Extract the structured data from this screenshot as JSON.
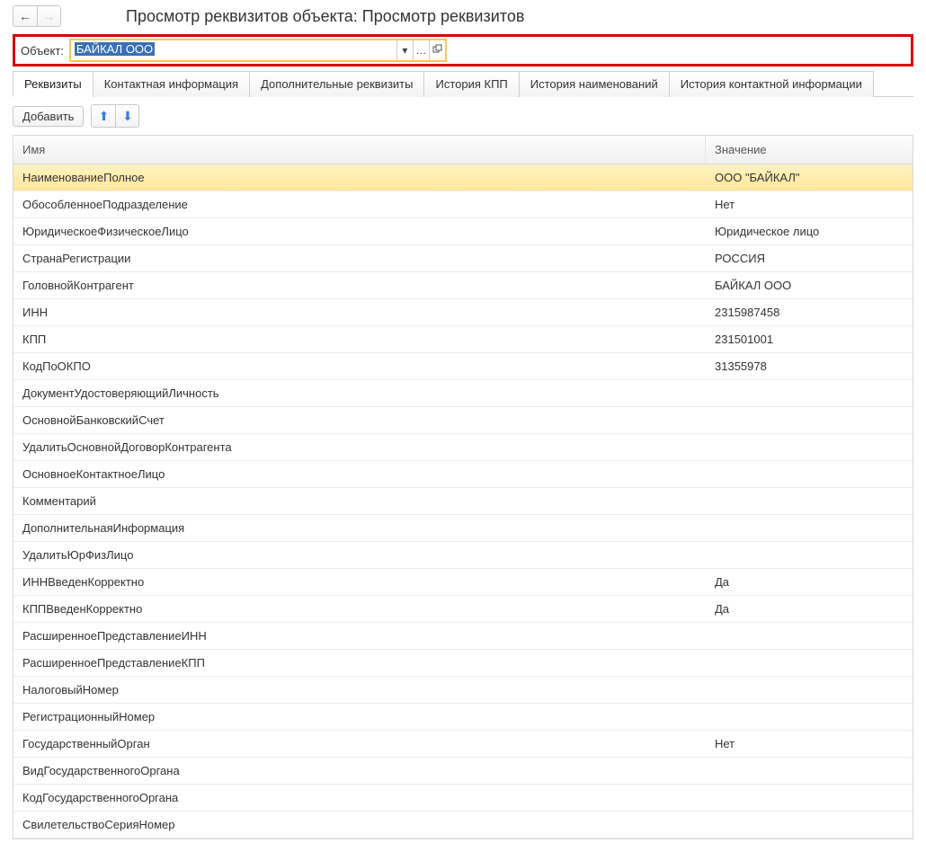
{
  "title": "Просмотр реквизитов объекта: Просмотр реквизитов",
  "object": {
    "label": "Объект:",
    "value": "БАЙКАЛ ООО"
  },
  "tabs": [
    "Реквизиты",
    "Контактная информация",
    "Дополнительные реквизиты",
    "История КПП",
    "История наименований",
    "История контактной информации"
  ],
  "activeTab": 0,
  "toolbar": {
    "add_label": "Добавить"
  },
  "table": {
    "headers": {
      "name": "Имя",
      "value": "Значение"
    },
    "rows": [
      {
        "name": "НаименованиеПолное",
        "value": "ООО \"БАЙКАЛ\"",
        "selected": true
      },
      {
        "name": "ОбособленноеПодразделение",
        "value": "Нет"
      },
      {
        "name": "ЮридическоеФизическоеЛицо",
        "value": "Юридическое лицо"
      },
      {
        "name": "СтранаРегистрации",
        "value": "РОССИЯ"
      },
      {
        "name": "ГоловнойКонтрагент",
        "value": "БАЙКАЛ ООО"
      },
      {
        "name": "ИНН",
        "value": "2315987458"
      },
      {
        "name": "КПП",
        "value": "231501001"
      },
      {
        "name": "КодПоОКПО",
        "value": "31355978"
      },
      {
        "name": "ДокументУдостоверяющийЛичность",
        "value": ""
      },
      {
        "name": "ОсновнойБанковскийСчет",
        "value": ""
      },
      {
        "name": "УдалитьОсновнойДоговорКонтрагента",
        "value": ""
      },
      {
        "name": "ОсновноеКонтактноеЛицо",
        "value": ""
      },
      {
        "name": "Комментарий",
        "value": ""
      },
      {
        "name": "ДополнительнаяИнформация",
        "value": ""
      },
      {
        "name": "УдалитьЮрФизЛицо",
        "value": ""
      },
      {
        "name": "ИННВведенКорректно",
        "value": "Да"
      },
      {
        "name": "КППВведенКорректно",
        "value": "Да"
      },
      {
        "name": "РасширенноеПредставлениеИНН",
        "value": ""
      },
      {
        "name": "РасширенноеПредставлениеКПП",
        "value": ""
      },
      {
        "name": "НалоговыйНомер",
        "value": ""
      },
      {
        "name": "РегистрационныйНомер",
        "value": ""
      },
      {
        "name": "ГосударственныйОрган",
        "value": "Нет"
      },
      {
        "name": "ВидГосударственногоОргана",
        "value": ""
      },
      {
        "name": "КодГосударственногоОргана",
        "value": ""
      },
      {
        "name": "СвилетельствоСерияНомер",
        "value": ""
      }
    ]
  }
}
